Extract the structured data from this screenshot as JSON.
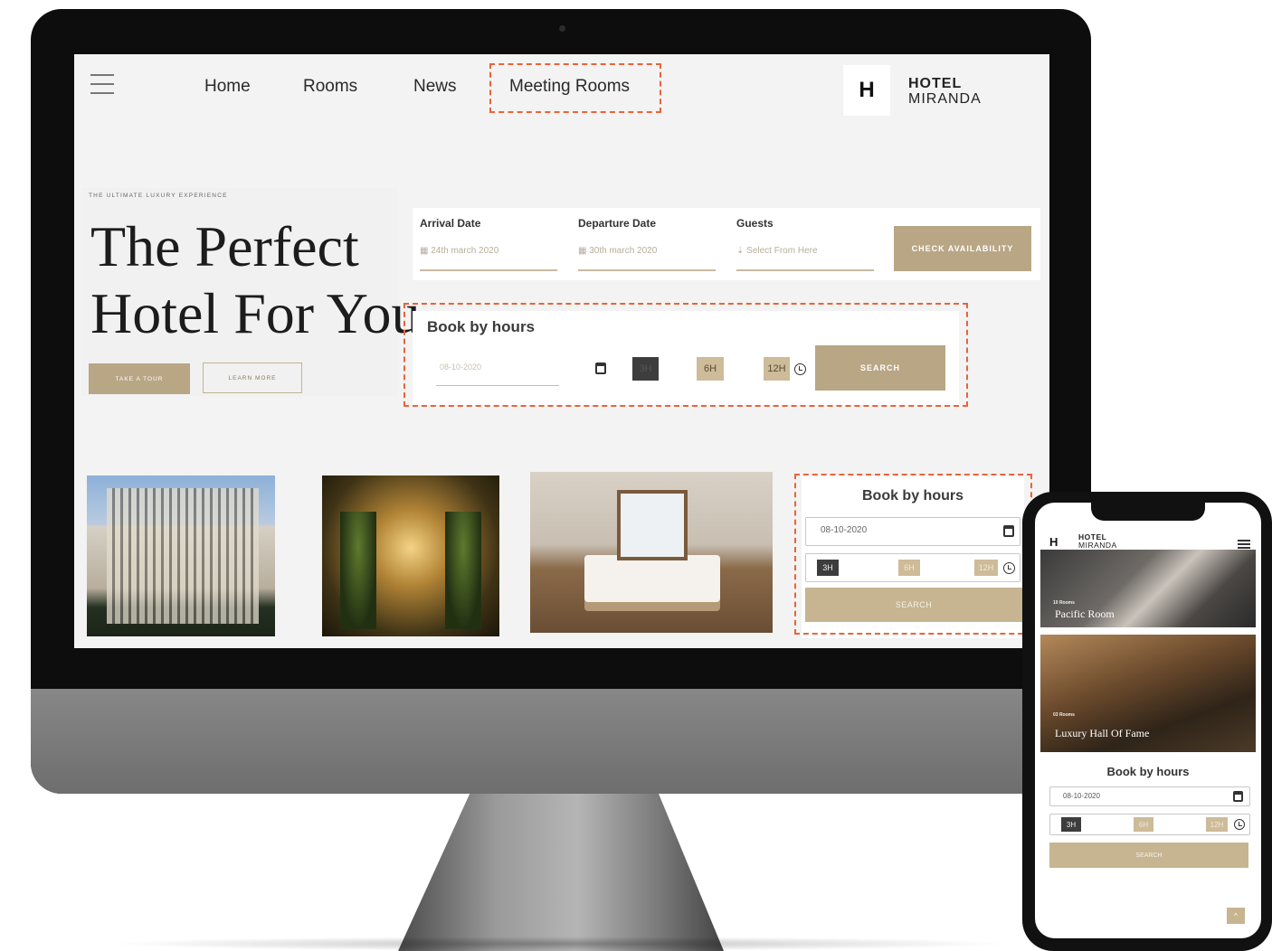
{
  "desktop": {
    "nav": {
      "links": [
        "Home",
        "Rooms",
        "News",
        "Meeting Rooms"
      ]
    },
    "logo": {
      "mark": "H",
      "line1": "HOTEL",
      "line2": "MIRANDA"
    },
    "hero": {
      "tagline": "THE ULTIMATE LUXURY EXPERIENCE",
      "title_line1": "The Perfect",
      "title_line2": "Hotel For You",
      "tour_button": "TAKE A TOUR",
      "learn_button": "LEARN MORE"
    },
    "booking": {
      "arrival_label": "Arrival Date",
      "arrival_value": "24th march 2020",
      "departure_label": "Departure Date",
      "departure_value": "30th march 2020",
      "guests_label": "Guests",
      "guests_placeholder": "Select From Here",
      "check_button": "CHECK AVAILABILITY"
    },
    "book_by_hours": {
      "title": "Book by hours",
      "date": "08-10-2020",
      "options": [
        "3H",
        "6H",
        "12H"
      ],
      "search_button": "SEARCH"
    },
    "side_book_by_hours": {
      "title": "Book by hours",
      "date": "08-10-2020",
      "options": [
        "3H",
        "6H",
        "12H"
      ],
      "search_button": "SEARCH"
    }
  },
  "mobile": {
    "logo": {
      "mark": "H",
      "line1": "HOTEL",
      "line2": "MIRANDA"
    },
    "rooms": [
      {
        "count": "10 Rooms",
        "name": "Pacific Room"
      },
      {
        "count": "03 Rooms",
        "name": "Luxury Hall Of Fame"
      }
    ],
    "book_by_hours": {
      "title": "Book by hours",
      "date": "08-10-2020",
      "options": [
        "3H",
        "6H",
        "12H"
      ],
      "search_button": "SEARCH"
    },
    "back_to_top": "^"
  },
  "colors": {
    "accent_tan": "#b9a685",
    "highlight_dash": "#e8643a",
    "dark_chip": "#3d3d3d",
    "screen_bg": "#f3f3f3"
  }
}
